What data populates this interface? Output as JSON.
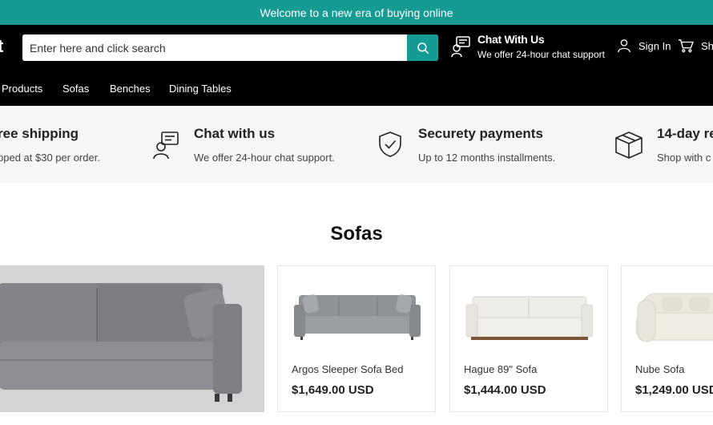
{
  "announcement": "Welcome to a new era of buying online",
  "header": {
    "logo_fragment": "t",
    "search_placeholder": "Enter here and click search",
    "chat": {
      "title": "Chat With Us",
      "subtitle": "We offer 24-hour chat support"
    },
    "signin_label": "Sign In",
    "cart_label": "Sh"
  },
  "nav": {
    "items": [
      "Products",
      "Sofas",
      "Benches",
      "Dining Tables"
    ]
  },
  "features": [
    {
      "title": "ree shipping",
      "subtitle": "pped at $30 per order.",
      "icon": "truck-icon"
    },
    {
      "title": "Chat with us",
      "subtitle": "We offer 24-hour chat support.",
      "icon": "chat-icon"
    },
    {
      "title": "Securety payments",
      "subtitle": "Up to 12 months installments.",
      "icon": "shield-check-icon"
    },
    {
      "title": "14-day re",
      "subtitle": "Shop with c",
      "icon": "box-icon"
    }
  ],
  "section": {
    "title": "Sofas"
  },
  "products": [
    {
      "name": "Argos Sleeper Sofa Bed",
      "price": "$1,649.00 USD",
      "color": "#8f9297"
    },
    {
      "name": "Hague 89\" Sofa",
      "price": "$1,444.00 USD",
      "color": "#eeece7"
    },
    {
      "name": "Nube Sofa",
      "price": "$1,249.00 USD",
      "color": "#ece8df"
    }
  ],
  "colors": {
    "accent": "#169b94",
    "header_bg": "#000000",
    "feature_bg": "#f6f6f6"
  }
}
